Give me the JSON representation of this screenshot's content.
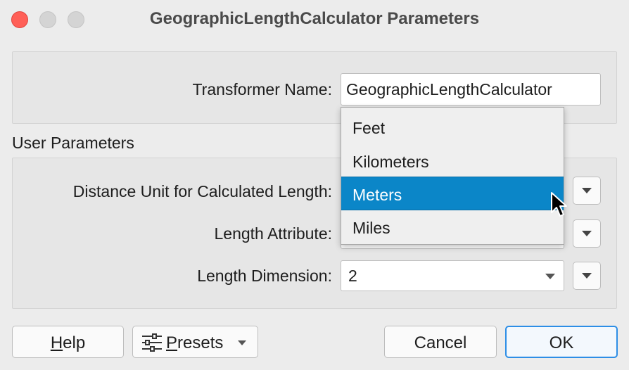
{
  "window": {
    "title": "GeographicLengthCalculator Parameters"
  },
  "transformer": {
    "name_label": "Transformer Name:",
    "name_value": "GeographicLengthCalculator"
  },
  "user_parameters": {
    "section_title": "User Parameters",
    "distance_unit_label": "Distance Unit for Calculated Length:",
    "length_attribute_label": "Length Attribute:",
    "length_dimension_label": "Length Dimension:",
    "length_dimension_value": "2"
  },
  "dropdown": {
    "options": [
      "Feet",
      "Kilometers",
      "Meters",
      "Miles"
    ],
    "selected": "Meters"
  },
  "buttons": {
    "help": "Help",
    "presets": "Presets",
    "cancel": "Cancel",
    "ok": "OK"
  },
  "colors": {
    "selection": "#0b86c8",
    "close": "#ff5f57",
    "ok_border": "#2d8ee6"
  }
}
